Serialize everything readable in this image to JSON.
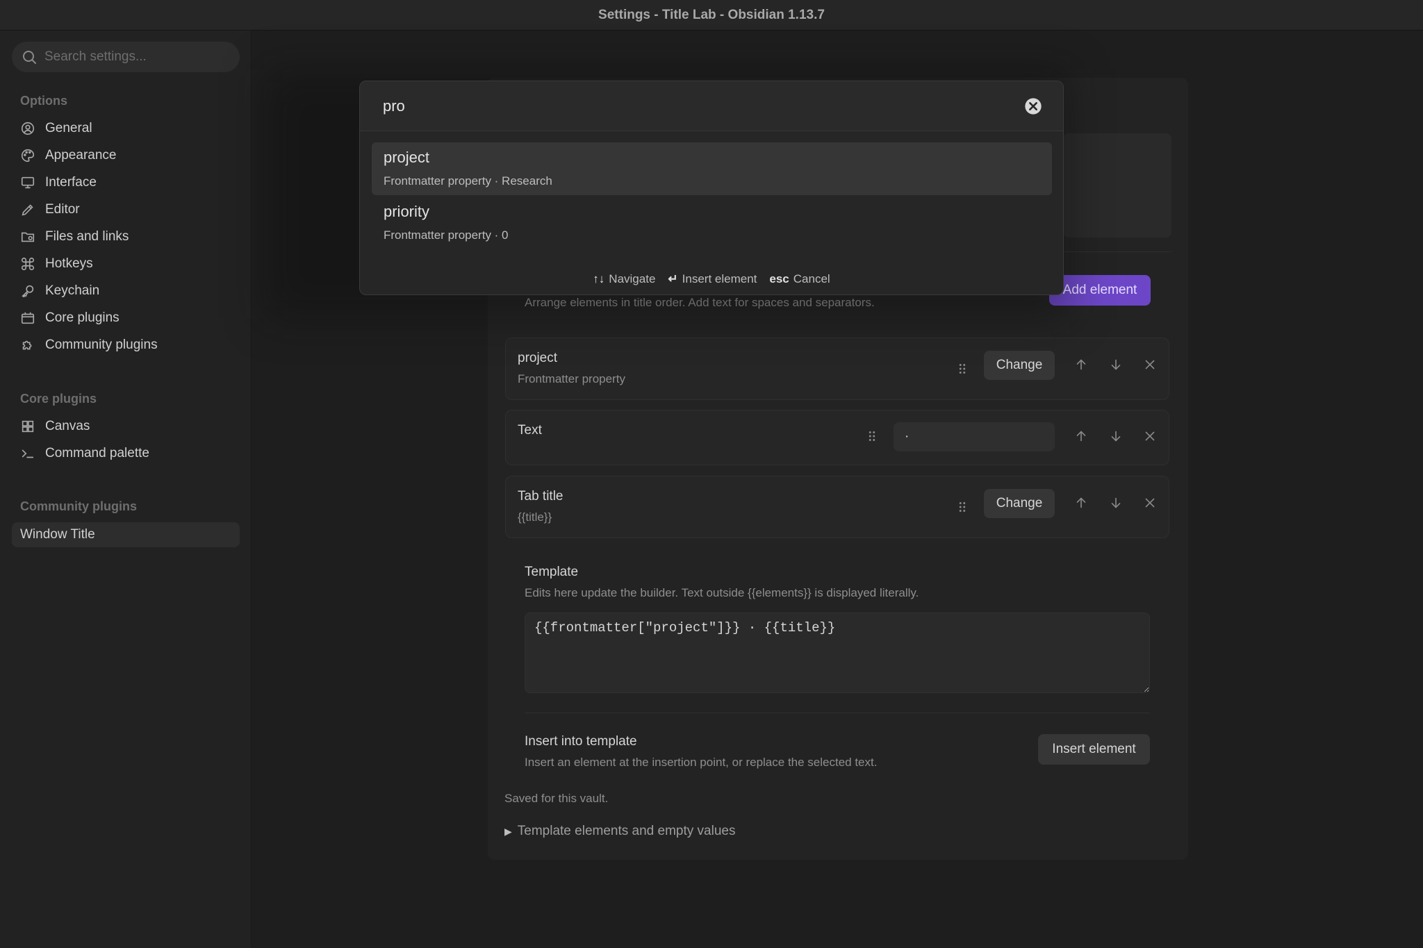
{
  "window": {
    "title": "Settings - Title Lab - Obsidian 1.13.7"
  },
  "sidebar": {
    "search_placeholder": "Search settings...",
    "sections": [
      {
        "heading": "Options",
        "items": [
          {
            "label": "General",
            "icon": "user-circle-icon"
          },
          {
            "label": "Appearance",
            "icon": "palette-icon"
          },
          {
            "label": "Interface",
            "icon": "monitor-icon"
          },
          {
            "label": "Editor",
            "icon": "pencil-icon"
          },
          {
            "label": "Files and links",
            "icon": "folder-icon"
          },
          {
            "label": "Hotkeys",
            "icon": "command-icon"
          },
          {
            "label": "Keychain",
            "icon": "key-icon"
          },
          {
            "label": "Core plugins",
            "icon": "calendar-icon"
          },
          {
            "label": "Community plugins",
            "icon": "puzzle-icon"
          }
        ]
      },
      {
        "heading": "Core plugins",
        "items": [
          {
            "label": "Canvas",
            "icon": "grid-icon"
          },
          {
            "label": "Command palette",
            "icon": "terminal-icon"
          }
        ]
      },
      {
        "heading": "Community plugins",
        "items": [
          {
            "label": "Window Title",
            "active": true
          }
        ]
      }
    ]
  },
  "modal": {
    "query": "pro",
    "suggestions": [
      {
        "title": "project",
        "subtitle": "Frontmatter property · Research",
        "selected": true
      },
      {
        "title": "priority",
        "subtitle": "Frontmatter property · 0",
        "selected": false
      }
    ],
    "footer": [
      {
        "key": "↑↓",
        "label": "Navigate"
      },
      {
        "key": "↵",
        "label": "Insert element"
      },
      {
        "key": "esc",
        "label": "Cancel"
      }
    ]
  },
  "builder": {
    "add_button": "Add element",
    "description": "Arrange elements in title order. Add text for spaces and separators.",
    "rows": [
      {
        "title": "project",
        "subtitle": "Frontmatter property",
        "button": "Change"
      },
      {
        "title": "Text",
        "value": "·"
      },
      {
        "title": "Tab title",
        "subtitle": "{{title}}",
        "button": "Change"
      }
    ]
  },
  "template": {
    "label": "Template",
    "description": "Edits here update the builder. Text outside {{elements}} is displayed literally.",
    "value": "{{frontmatter[\"project\"]}} · {{title}}"
  },
  "insert": {
    "label": "Insert into template",
    "description": "Insert an element at the insertion point, or replace the selected text.",
    "button": "Insert element"
  },
  "saved_note": "Saved for this vault.",
  "details_summary": "Template elements and empty values",
  "colors": {
    "accent": "#6c46c7",
    "background": "#1e1e1e",
    "sidebar": "#222222"
  }
}
